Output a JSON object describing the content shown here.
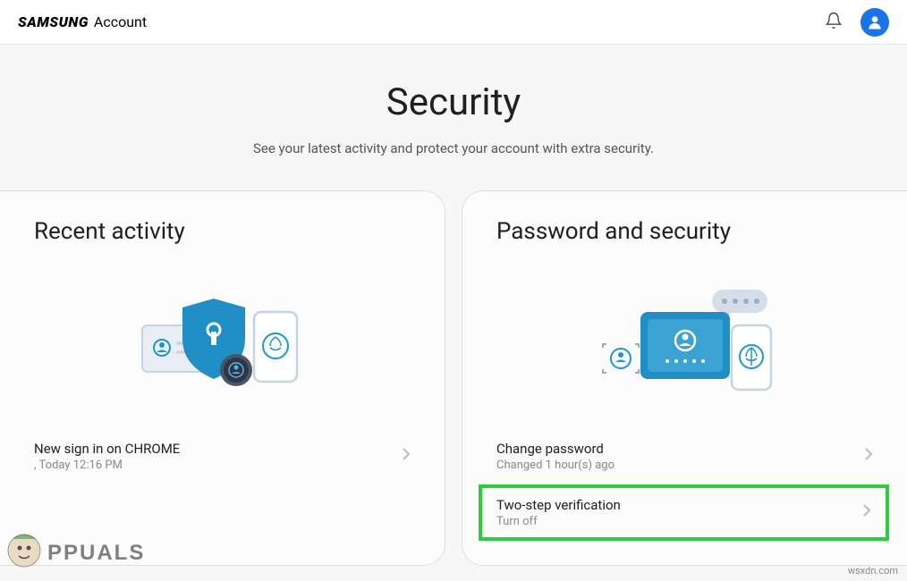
{
  "header": {
    "logo_brand": "SAMSUNG",
    "logo_sub": "Account"
  },
  "page": {
    "title": "Security",
    "subtitle": "See your latest activity and protect your account with extra security."
  },
  "cards": {
    "recent_activity": {
      "title": "Recent activity",
      "items": [
        {
          "title": "New sign in on CHROME",
          "subtitle": ", Today 12:16 PM"
        }
      ]
    },
    "password_security": {
      "title": "Password and security",
      "items": [
        {
          "title": "Change password",
          "subtitle": "Changed 1 hour(s) ago"
        },
        {
          "title": "Two-step verification",
          "subtitle": "Turn off"
        }
      ]
    }
  },
  "watermarks": {
    "appuals": "APPUALS",
    "wsxdn": "wsxdn.com"
  }
}
